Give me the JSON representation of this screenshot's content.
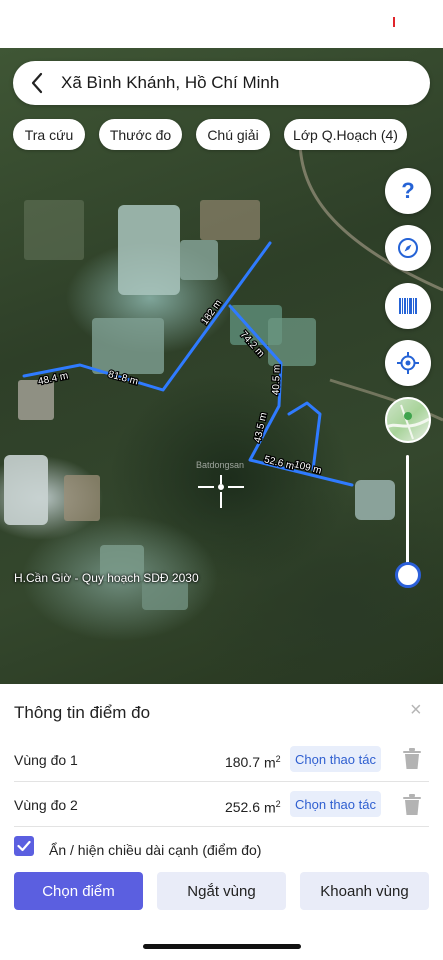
{
  "search": {
    "title": "Xã Bình Khánh, Hồ Chí Minh"
  },
  "chips": [
    {
      "label": "Tra cứu"
    },
    {
      "label": "Thước đo"
    },
    {
      "label": "Chú giải"
    },
    {
      "label": "Lớp Q.Hoạch (4)"
    }
  ],
  "side_buttons": {
    "help_icon": "question-mark",
    "compass_icon": "compass",
    "barcode_icon": "barcode",
    "locate_icon": "crosshair",
    "help_glyph": "?"
  },
  "map": {
    "caption": "H.Cần Giờ - Quy hoạch SDĐ 2030",
    "watermark": "Batdongsan",
    "segment_labels": {
      "a": "48.4 m",
      "b": "81.8 m",
      "c": "182 m",
      "d": "74.2 m",
      "e": "40.5 m",
      "f": "43.5 m",
      "g": "52.6 m",
      "h": "109 m"
    },
    "line_color": "#2f7bff"
  },
  "panel": {
    "title": "Thông tin điểm đo",
    "close_glyph": "×",
    "rows": [
      {
        "label": "Vùng đo 1",
        "value": "180.7",
        "unit": "m",
        "unit_power": "2",
        "action": "Chọn thao tác"
      },
      {
        "label": "Vùng đo 2",
        "value": "252.6",
        "unit": "m",
        "unit_power": "2",
        "action": "Chọn thao tác"
      }
    ],
    "checkbox_label": "Ẩn / hiện chiều dài cạnh (điểm đo)",
    "checkbox_checked": true,
    "buttons": {
      "primary": "Chọn điểm",
      "cut": "Ngắt vùng",
      "area": "Khoanh vùng"
    }
  },
  "colors": {
    "accent": "#5b5fe0",
    "action_text": "#2f5fd0",
    "icon_blue": "#2563d6"
  }
}
